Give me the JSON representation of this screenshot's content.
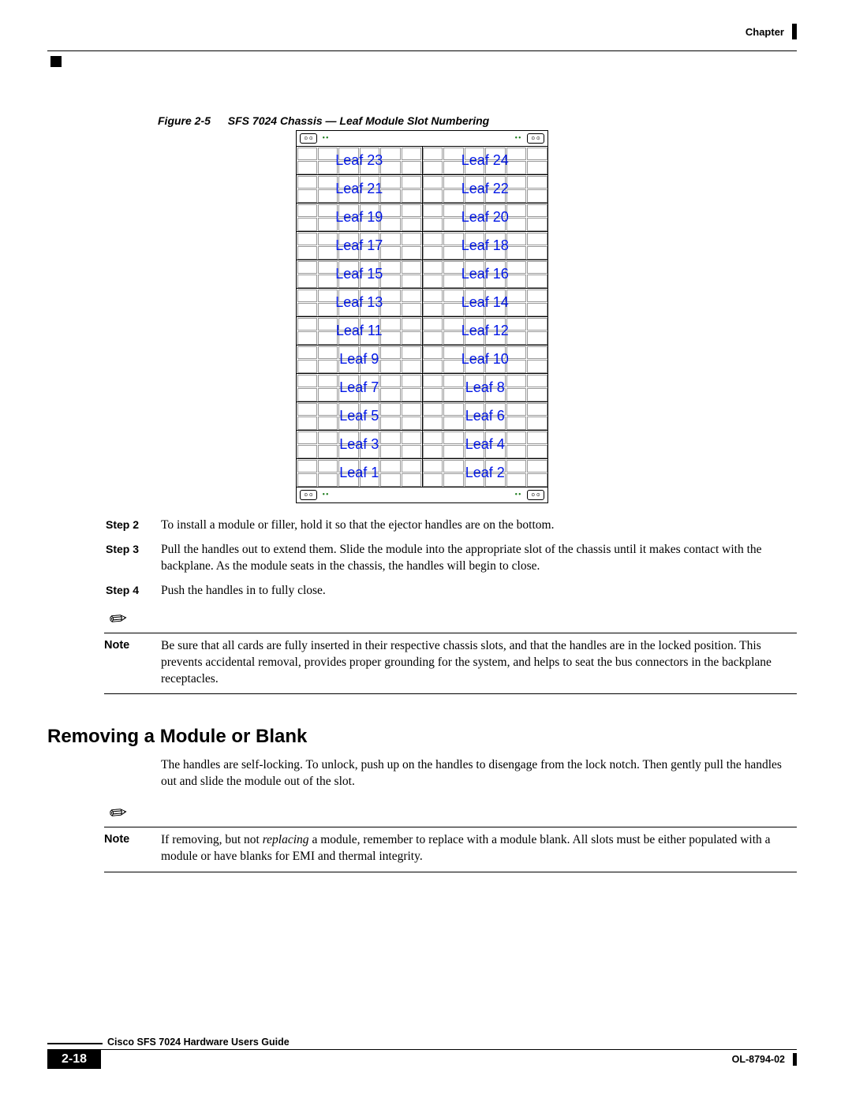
{
  "header": {
    "chapter_label": "Chapter"
  },
  "figure": {
    "number": "Figure 2-5",
    "title": "SFS 7024 Chassis — Leaf Module Slot Numbering",
    "top_half_left": [
      "Leaf 23",
      "Leaf 21",
      "Leaf 19",
      "Leaf 17",
      "Leaf 15",
      "Leaf 13"
    ],
    "top_half_right": [
      "Leaf 24",
      "Leaf 22",
      "Leaf 20",
      "Leaf 18",
      "Leaf 16",
      "Leaf 14"
    ],
    "bottom_half_left": [
      "Leaf 11",
      "Leaf 9",
      "Leaf 7",
      "Leaf 5",
      "Leaf 3",
      "Leaf 1"
    ],
    "bottom_half_right": [
      "Leaf 12",
      "Leaf 10",
      "Leaf 8",
      "Leaf 6",
      "Leaf 4",
      "Leaf 2"
    ]
  },
  "steps": {
    "s2_label": "Step 2",
    "s2_text": "To install a module or filler, hold it so that the ejector handles are on the bottom.",
    "s3_label": "Step 3",
    "s3_text": "Pull the handles out to extend them. Slide the module into the appropriate slot of the chassis until it makes contact with the backplane. As the module seats in the chassis, the handles will begin to close.",
    "s4_label": "Step 4",
    "s4_text": "Push the handles in to fully close."
  },
  "note1": {
    "label": "Note",
    "text": "Be sure that all cards are fully inserted in their respective chassis slots, and that the handles are in the locked position. This prevents accidental removal, provides proper grounding for the system, and helps to seat the bus connectors in the backplane receptacles."
  },
  "section": {
    "heading": "Removing a Module or Blank",
    "para": "The handles are self-locking. To unlock, push up on the handles to disengage from the lock notch. Then gently pull the handles out and slide the module out of the slot."
  },
  "note2": {
    "label": "Note",
    "text_pre": "If removing, but not ",
    "text_em": "replacing",
    "text_post": " a module, remember to replace with a module blank. All slots must be either populated with a module or have blanks for EMI and thermal integrity."
  },
  "footer": {
    "guide_title": "Cisco SFS 7024 Hardware Users Guide",
    "page_number": "2-18",
    "doc_id": "OL-8794-02"
  }
}
